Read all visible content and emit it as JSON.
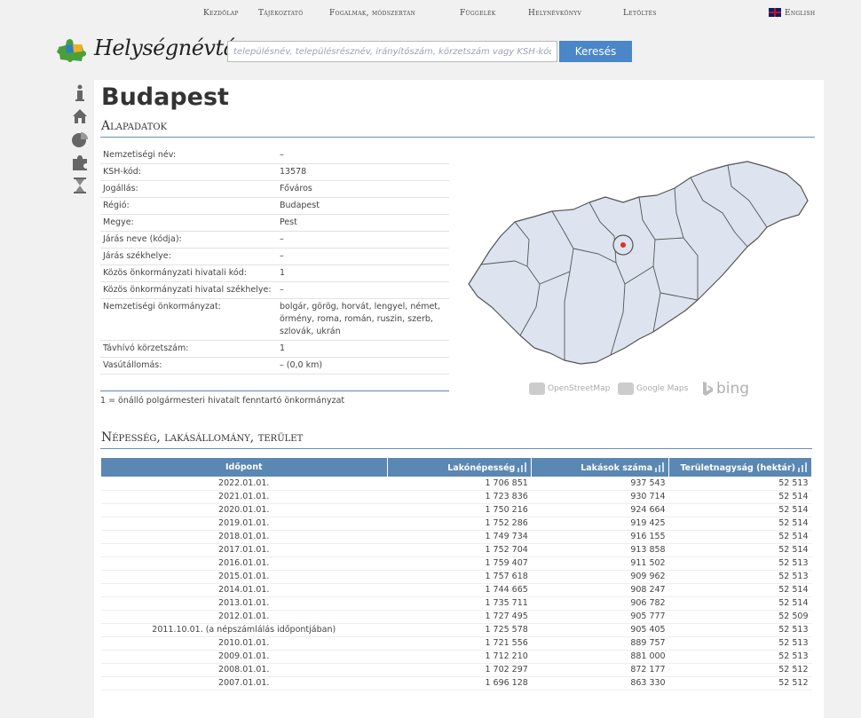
{
  "nav": {
    "items": [
      "Kezdőlap",
      "Tájékoztató",
      "Fogalmak, módszertan",
      "Függelék",
      "Helynévkönyv",
      "Letöltés"
    ],
    "english": "English"
  },
  "header": {
    "logo": "Helységnévtár",
    "search_placeholder": "településnév, településrésznév, irányítószám, körzetszám vagy KSH-kód",
    "search_button": "Keresés"
  },
  "page": {
    "title": "Budapest",
    "section_basic": "Alapadatok",
    "section_population": "Népesség, lakásállomány, terület"
  },
  "basic_data": [
    {
      "label": "Nemzetiségi név:",
      "value": "–"
    },
    {
      "label": "KSH-kód:",
      "value": "13578"
    },
    {
      "label": "Jogállás:",
      "value": "Főváros"
    },
    {
      "label": "Régió:",
      "value": "Budapest"
    },
    {
      "label": "Megye:",
      "value": "Pest"
    },
    {
      "label": "Járás neve (kódja):",
      "value": "–"
    },
    {
      "label": "Járás székhelye:",
      "value": "–"
    },
    {
      "label": "Közös önkormányzati hivatali kód:",
      "value": "1"
    },
    {
      "label": "Közös önkormányzati hivatal székhelye:",
      "value": "–"
    },
    {
      "label": "Nemzetiségi önkormányzat:",
      "value": "bolgár, görög, horvát, lengyel, német, örmény, roma, román, ruszin, szerb, szlovák, ukrán"
    },
    {
      "label": "Távhívó körzetszám:",
      "value": "1"
    },
    {
      "label": "Vasútállomás:",
      "value": "– (0,0 km)"
    }
  ],
  "footnote": "1 = önálló polgármesteri hivatalt fenntartó önkormányzat",
  "map_providers": [
    "OpenStreetMap",
    "Google Maps",
    "bing"
  ],
  "population_table": {
    "headers": [
      "Időpont",
      "Lakónépesség",
      "Lakások száma",
      "Területnagyság (hektár)"
    ],
    "rows": [
      [
        "2022.01.01.",
        "1 706 851",
        "937 543",
        "52 513"
      ],
      [
        "2021.01.01.",
        "1 723 836",
        "930 714",
        "52 514"
      ],
      [
        "2020.01.01.",
        "1 750 216",
        "924 664",
        "52 514"
      ],
      [
        "2019.01.01.",
        "1 752 286",
        "919 425",
        "52 514"
      ],
      [
        "2018.01.01.",
        "1 749 734",
        "916 155",
        "52 514"
      ],
      [
        "2017.01.01.",
        "1 752 704",
        "913 858",
        "52 514"
      ],
      [
        "2016.01.01.",
        "1 759 407",
        "911 502",
        "52 513"
      ],
      [
        "2015.01.01.",
        "1 757 618",
        "909 962",
        "52 513"
      ],
      [
        "2014.01.01.",
        "1 744 665",
        "908 247",
        "52 514"
      ],
      [
        "2013.01.01.",
        "1 735 711",
        "906 782",
        "52 514"
      ],
      [
        "2012.01.01.",
        "1 727 495",
        "905 777",
        "52 509"
      ],
      [
        "2011.10.01. (a népszámlálás időpontjában)",
        "1 725 578",
        "905 405",
        "52 513"
      ],
      [
        "2010.01.01.",
        "1 721 556",
        "889 757",
        "52 513"
      ],
      [
        "2009.01.01.",
        "1 712 210",
        "881 000",
        "52 513"
      ],
      [
        "2008.01.01.",
        "1 702 297",
        "872 177",
        "52 512"
      ],
      [
        "2007.01.01.",
        "1 696 128",
        "863 330",
        "52 512"
      ]
    ]
  },
  "colors": {
    "accent": "#5b87b3",
    "button": "#4a86c8",
    "map_fill": "#dde3ef",
    "marker": "#e03020"
  }
}
